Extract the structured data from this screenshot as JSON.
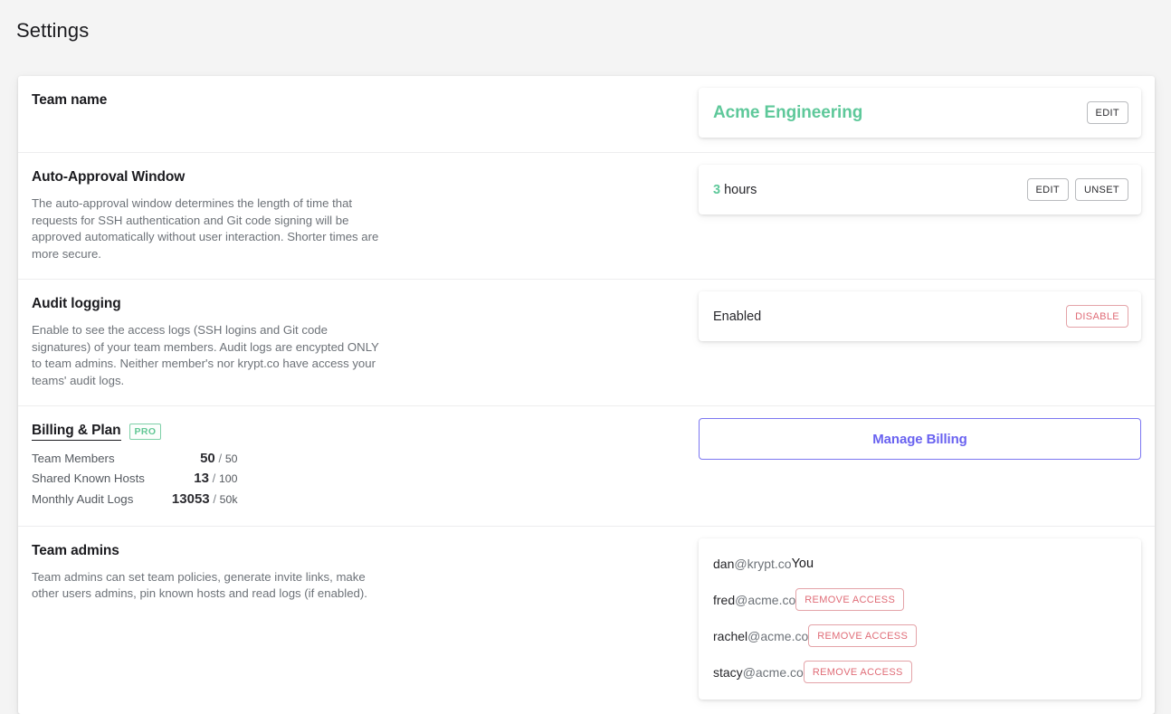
{
  "page": {
    "title": "Settings"
  },
  "sections": {
    "team_name": {
      "heading": "Team name",
      "value": "Acme Engineering",
      "edit_label": "EDIT"
    },
    "auto_approval": {
      "heading": "Auto-Approval Window",
      "description": "The auto-approval window determines the length of time that requests for SSH authentication and Git code signing will be approved automatically without user interaction. Shorter times are more secure.",
      "value_number": "3",
      "value_unit": "hours",
      "edit_label": "EDIT",
      "unset_label": "UNSET"
    },
    "audit_logging": {
      "heading": "Audit logging",
      "description": "Enable to see the access logs (SSH logins and Git code signatures) of your team members. Audit logs are encypted ONLY to team admins. Neither member's nor krypt.co have access your teams' audit logs.",
      "status": "Enabled",
      "disable_label": "DISABLE"
    },
    "billing": {
      "heading": "Billing & Plan",
      "plan_badge": "PRO",
      "usage": [
        {
          "label": "Team Members",
          "current": "50",
          "separator": "/",
          "limit": "50"
        },
        {
          "label": "Shared Known Hosts",
          "current": "13",
          "separator": "/",
          "limit": "100"
        },
        {
          "label": "Monthly Audit Logs",
          "current": "13053",
          "separator": "/",
          "limit": "50k"
        }
      ],
      "manage_label": "Manage Billing"
    },
    "team_admins": {
      "heading": "Team admins",
      "description": "Team admins can set team policies, generate invite links, make other users admins, pin known hosts and read logs (if enabled).",
      "you_label": "You",
      "remove_label": "REMOVE ACCESS",
      "admins": [
        {
          "user": "dan",
          "domain": "@krypt.co",
          "is_you": true
        },
        {
          "user": "fred",
          "domain": "@acme.co",
          "is_you": false
        },
        {
          "user": "rachel",
          "domain": "@acme.co",
          "is_you": false
        },
        {
          "user": "stacy",
          "domain": "@acme.co",
          "is_you": false
        }
      ]
    }
  },
  "colors": {
    "accent_green": "#5ec89a",
    "accent_purple": "#6962f0",
    "accent_red": "#e06c77",
    "background": "#f4f4f4"
  }
}
